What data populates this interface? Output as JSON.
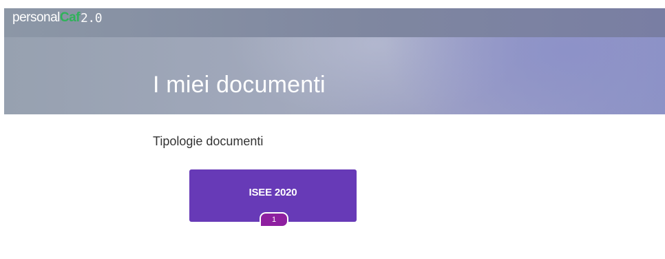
{
  "brand": {
    "part1": "personal",
    "part2": "Caf",
    "part3": "2.0"
  },
  "header": {
    "title": "I miei documenti"
  },
  "section": {
    "title": "Tipologie documenti"
  },
  "document_types": [
    {
      "label": "ISEE 2020",
      "count": "1"
    }
  ],
  "colors": {
    "brand_green": "#2fb35a",
    "card_purple": "#673ab7",
    "badge_magenta": "#8e1fa0"
  }
}
